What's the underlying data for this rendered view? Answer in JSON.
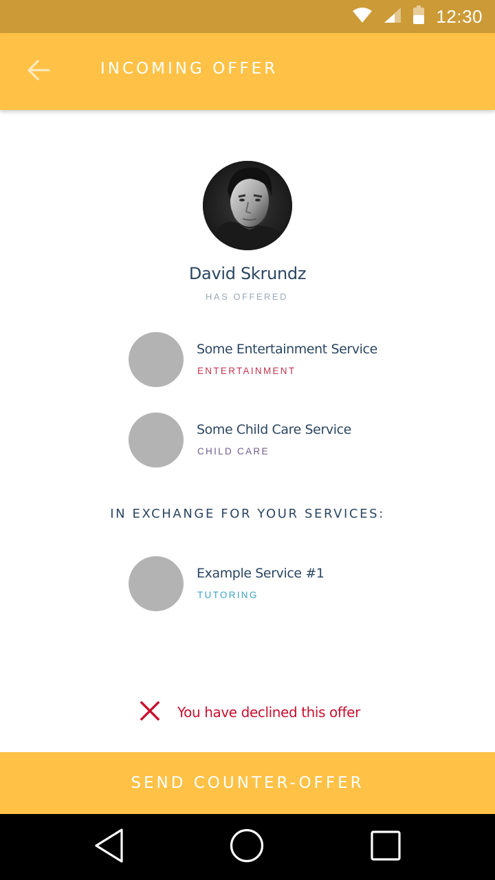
{
  "status_bar": {
    "time": "12:30",
    "background": "#cc9a36"
  },
  "app_bar": {
    "title": "INCOMING OFFER",
    "background": "#ffc247",
    "back_icon": "arrow-back-icon"
  },
  "offerer": {
    "name": "David Skrundz",
    "subtitle": "HAS OFFERED"
  },
  "offered_services": [
    {
      "name": "Some Entertainment Service",
      "category": "ENTERTAINMENT",
      "category_color": "#c2334f"
    },
    {
      "name": "Some Child Care Service",
      "category": "CHILD CARE",
      "category_color": "#6e5b8e"
    }
  ],
  "exchange": {
    "heading": "IN EXCHANGE FOR YOUR SERVICES:",
    "services": [
      {
        "name": "Example Service #1",
        "category": "TUTORING",
        "category_color": "#3aa3c4"
      }
    ]
  },
  "status": {
    "icon": "close-x-icon",
    "text": "You have declined this offer",
    "color": "#c8102e"
  },
  "actions": {
    "counter_offer_label": "SEND COUNTER-OFFER"
  },
  "nav_bar": {
    "back": "nav-back-icon",
    "home": "nav-home-icon",
    "recents": "nav-recents-icon"
  }
}
